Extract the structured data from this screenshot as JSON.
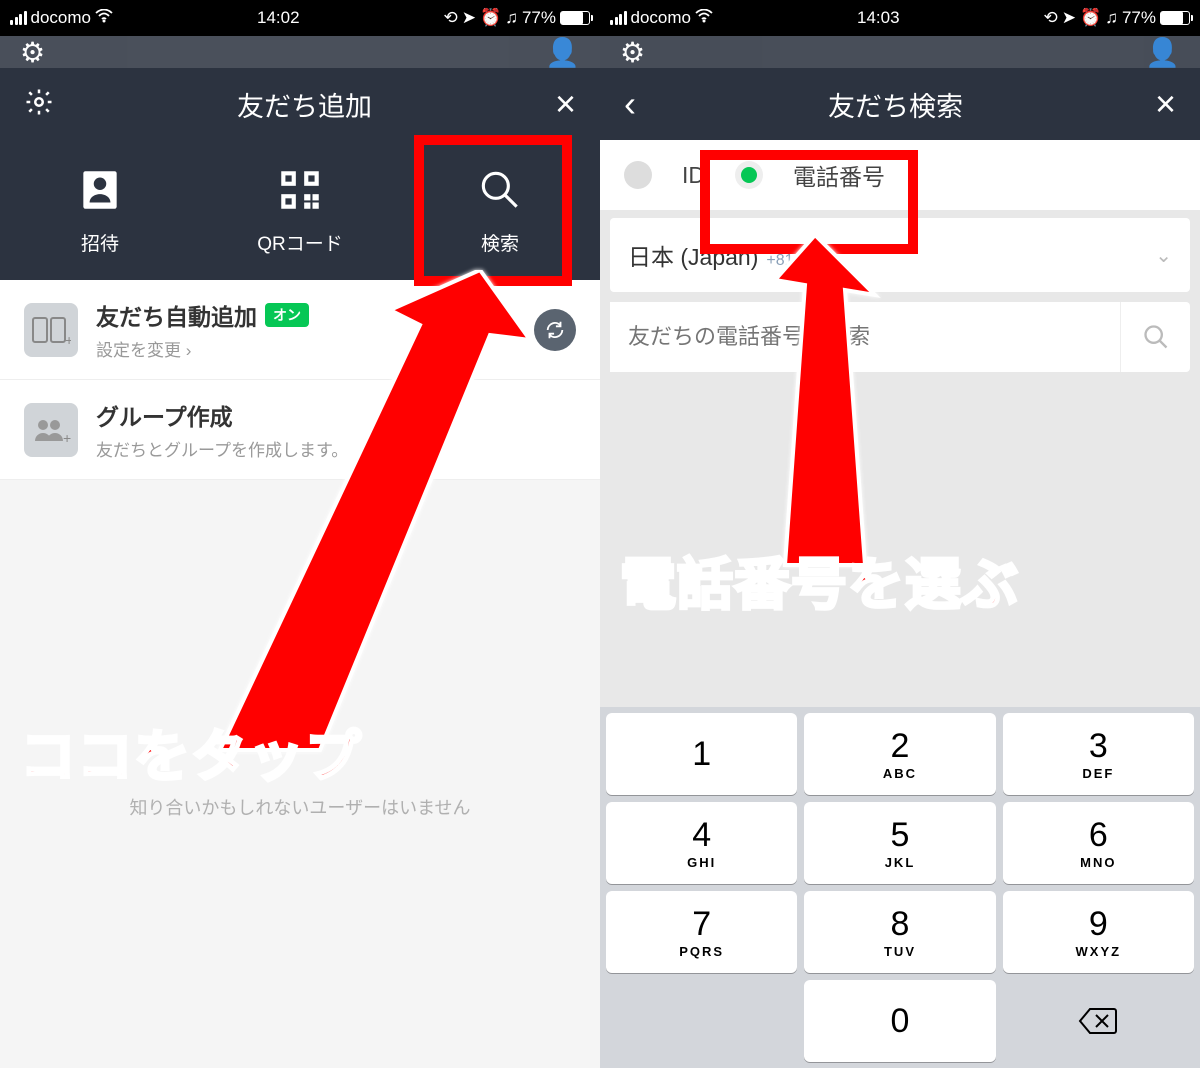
{
  "left": {
    "status": {
      "carrier": "docomo",
      "time": "14:02",
      "battery": "77%"
    },
    "title": "友だち追加",
    "methods": [
      {
        "label": "招待"
      },
      {
        "label": "QRコード"
      },
      {
        "label": "検索"
      }
    ],
    "autoAdd": {
      "title": "友だち自動追加",
      "badge": "オン",
      "sub": "設定を変更"
    },
    "group": {
      "title": "グループ作成",
      "sub": "友だちとグループを作成します。"
    },
    "empty": "知り合いかもしれないユーザーはいません",
    "annotation": "ココをタップ"
  },
  "right": {
    "status": {
      "carrier": "docomo",
      "time": "14:03",
      "battery": "77%"
    },
    "title": "友だち検索",
    "tabs": {
      "id": "ID",
      "phone": "電話番号"
    },
    "country": {
      "name": "日本 (Japan)",
      "code": "+81"
    },
    "search": {
      "placeholder": "友だちの電話番号で検索"
    },
    "keypad": [
      {
        "n": "1",
        "l": ""
      },
      {
        "n": "2",
        "l": "ABC"
      },
      {
        "n": "3",
        "l": "DEF"
      },
      {
        "n": "4",
        "l": "GHI"
      },
      {
        "n": "5",
        "l": "JKL"
      },
      {
        "n": "6",
        "l": "MNO"
      },
      {
        "n": "7",
        "l": "PQRS"
      },
      {
        "n": "8",
        "l": "TUV"
      },
      {
        "n": "9",
        "l": "WXYZ"
      },
      {
        "n": "",
        "l": "",
        "blank": true
      },
      {
        "n": "0",
        "l": ""
      },
      {
        "n": "del",
        "l": "",
        "del": true
      }
    ],
    "annotation": "電話番号を選ぶ"
  }
}
